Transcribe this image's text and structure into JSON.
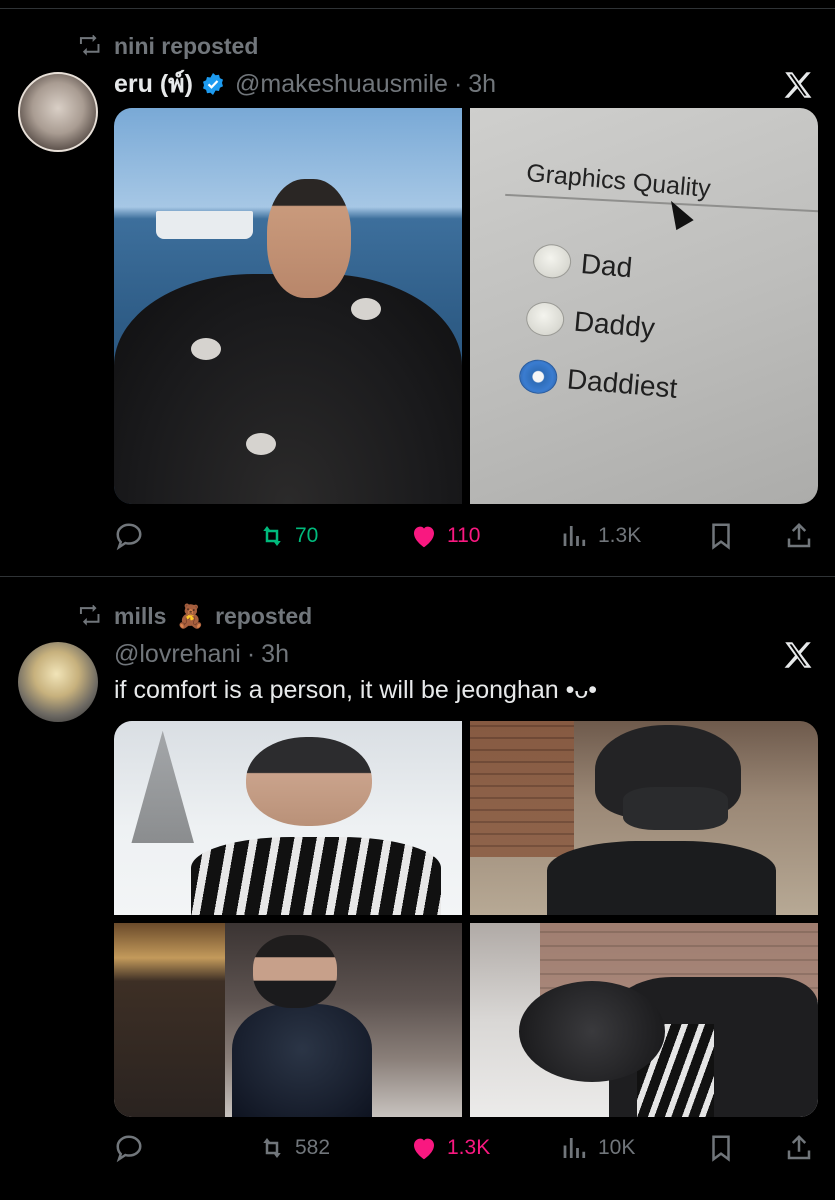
{
  "posts": [
    {
      "repost_label": "nini reposted",
      "author_name": "eru (พ์)",
      "verified": true,
      "handle": "@makeshuausmile",
      "time": "3h",
      "text": "",
      "images": [
        "man-on-boat-photo",
        "graphics-quality-screen-photo"
      ],
      "image_text": {
        "title": "Graphics Quality",
        "options": [
          "Dad",
          "Daddy",
          "Daddiest"
        ],
        "selected": "Daddiest"
      },
      "stats": {
        "replies": "",
        "reposts": "70",
        "likes": "110",
        "views": "1.3K"
      },
      "reposted_by_me": true,
      "liked": true
    },
    {
      "repost_label_name": "mills",
      "repost_label_emoji": "🧸",
      "repost_label_suffix": "reposted",
      "author_name": "",
      "handle": "@lovrehani",
      "time": "3h",
      "text": "if comfort is a person, it will be jeonghan •ᴗ•",
      "images": [
        "snow-portrait-photo",
        "masked-beanie-photo",
        "street-night-photo",
        "snow-hood-photo"
      ],
      "stats": {
        "replies": "",
        "reposts": "582",
        "likes": "1.3K",
        "views": "10K"
      },
      "reposted_by_me": false,
      "liked": true
    }
  ],
  "colors": {
    "background": "#000000",
    "text": "#e7e9ea",
    "muted": "#71767b",
    "repost_green": "#00ba7c",
    "like_pink": "#f91880",
    "verified_blue": "#1d9bf0"
  },
  "icons": {
    "reply": "reply-icon",
    "repost": "repost-icon",
    "like": "heart-icon",
    "views": "views-icon",
    "bookmark": "bookmark-icon",
    "share": "share-icon",
    "x": "x-logo-icon"
  }
}
